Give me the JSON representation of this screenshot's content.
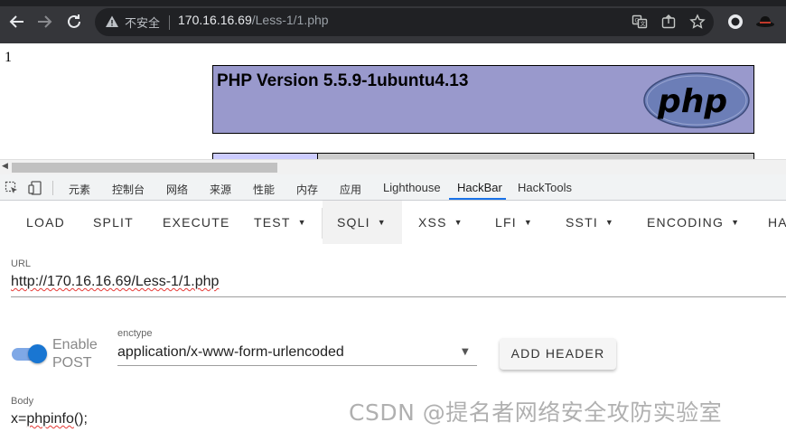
{
  "browser": {
    "security_text": "不安全",
    "url_host": "170.16.16.69",
    "url_path": "/Less-1/1.php",
    "icons": [
      "back-arrow-icon",
      "forward-arrow-icon",
      "reload-icon",
      "warning-icon",
      "translate-icon",
      "share-icon",
      "star-icon",
      "extension-icon",
      "profile-icon"
    ]
  },
  "page": {
    "output_text": "1",
    "php_version_title": "PHP Version 5.5.9-1ubuntu4.13",
    "colors": {
      "php_header": "#9999cc",
      "php_row": "#cccccc",
      "php_row_left": "#ccccff"
    }
  },
  "devtools": {
    "tabs": [
      "元素",
      "控制台",
      "网络",
      "来源",
      "性能",
      "内存",
      "应用",
      "Lighthouse",
      "HackBar",
      "HackTools"
    ],
    "active_tab": "HackBar",
    "accent": "#1a73e8"
  },
  "hackbar": {
    "toolbar": [
      {
        "label": "LOAD",
        "dropdown": false
      },
      {
        "label": "SPLIT",
        "dropdown": false
      },
      {
        "label": "EXECUTE",
        "dropdown": false
      },
      {
        "label": "TEST",
        "dropdown": true
      },
      {
        "label": "SQLI",
        "dropdown": true
      },
      {
        "label": "XSS",
        "dropdown": true
      },
      {
        "label": "LFI",
        "dropdown": true
      },
      {
        "label": "SSTI",
        "dropdown": true
      },
      {
        "label": "ENCODING",
        "dropdown": true
      },
      {
        "label": "HA",
        "dropdown": false
      }
    ],
    "url_label": "URL",
    "url_value": "http://170.16.16.69/Less-1/1.php",
    "post_toggle": {
      "label_line1": "Enable",
      "label_line2": "POST",
      "enabled": true,
      "color": "#1976d2"
    },
    "enctype_label": "enctype",
    "enctype_value": "application/x-www-form-urlencoded",
    "add_header_label": "ADD HEADER",
    "body_label": "Body",
    "body_value": "x=phpinfo();"
  },
  "watermark": "CSDN @提名者网络安全攻防实验室"
}
